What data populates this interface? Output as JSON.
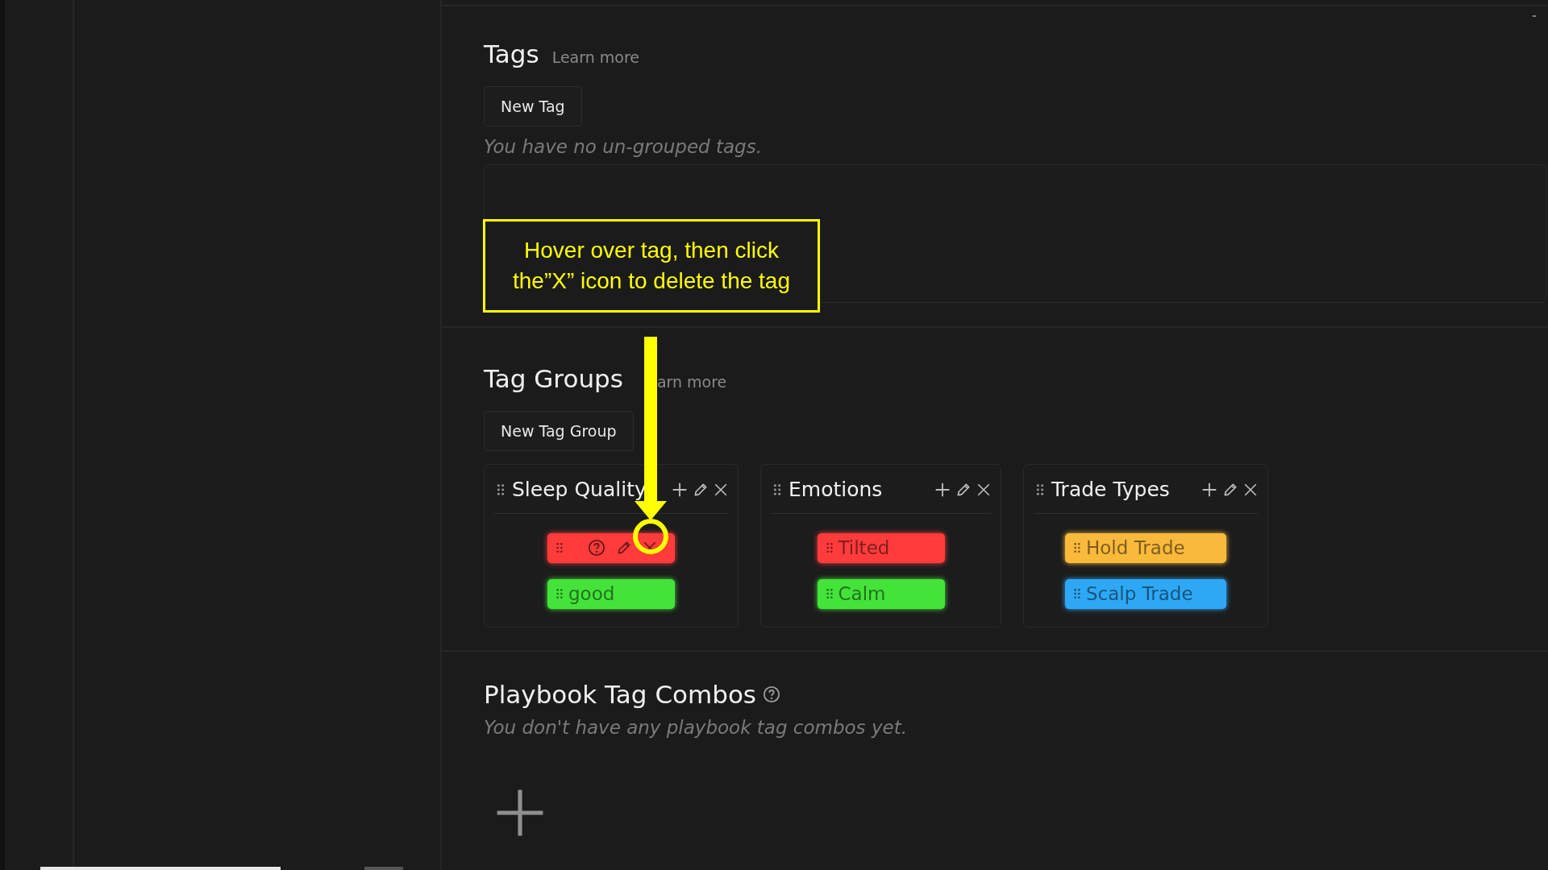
{
  "tags_section": {
    "title": "Tags",
    "learn_more": "Learn more",
    "new_button": "New Tag",
    "empty_text": "You have no un-grouped tags."
  },
  "tag_groups_section": {
    "title": "Tag Groups",
    "learn_more": "arn more",
    "new_button": "New Tag Group",
    "groups": [
      {
        "name": "Sleep Quality",
        "tags": [
          {
            "color": "#ff3b3b",
            "hovered": true
          },
          {
            "label": "good",
            "color": "#44e33a",
            "hovered": false
          }
        ]
      },
      {
        "name": "Emotions",
        "tags": [
          {
            "label": "Tilted",
            "color": "#ff3b3b",
            "hovered": false
          },
          {
            "label": "Calm",
            "color": "#44e33a",
            "hovered": false
          }
        ]
      },
      {
        "name": "Trade Types",
        "tags": [
          {
            "label": "Hold Trade",
            "color": "#f9b93b",
            "hovered": false
          },
          {
            "label": "Scalp Trade",
            "color": "#2ea8f5",
            "hovered": false
          }
        ]
      }
    ]
  },
  "playbook_section": {
    "title": "Playbook Tag Combos",
    "empty_text": "You don't have any playbook tag combos yet."
  },
  "annotation": {
    "text": "Hover over tag, then click the”X” icon to delete the tag"
  }
}
